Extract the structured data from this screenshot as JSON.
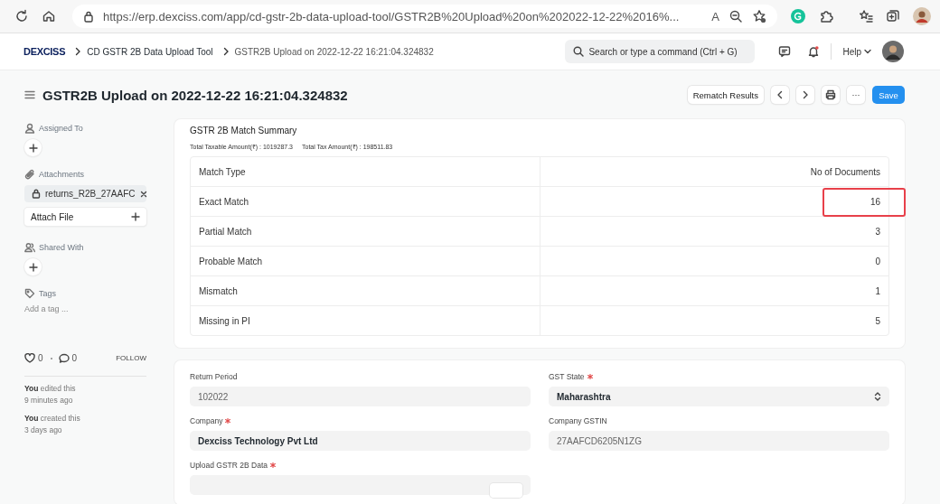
{
  "browser": {
    "url": "https://erp.dexciss.com/app/cd-gstr-2b-data-upload-tool/GSTR2B%20Upload%20on%202022-12-22%2016%...",
    "read_aloud": "A"
  },
  "navbar": {
    "logo": "DEXCISS",
    "breadcrumbs": [
      "CD GSTR 2B Data Upload Tool",
      "GSTR2B Upload on 2022-12-22 16:21:04.324832"
    ],
    "search_placeholder": "Search or type a command (Ctrl + G)",
    "notifications_unread": true,
    "help": "Help"
  },
  "page": {
    "title": "GSTR2B Upload on 2022-12-22 16:21:04.324832",
    "buttons": [
      {
        "kind": "text",
        "label": "Rematch Results"
      },
      {
        "kind": "prev"
      },
      {
        "kind": "next"
      },
      {
        "kind": "print"
      },
      {
        "kind": "more",
        "label": "···"
      },
      {
        "kind": "primary",
        "label": "Save"
      }
    ]
  },
  "sidebar": {
    "sections": [
      {
        "kind": "assign",
        "label": "Assigned To"
      },
      {
        "kind": "attachments",
        "label": "Attachments",
        "files": [
          "returns_R2B_27AAFC"
        ],
        "attach_label": "Attach File"
      },
      {
        "kind": "share",
        "label": "Shared With"
      },
      {
        "kind": "tags",
        "label": "Tags",
        "placeholder": "Add a tag ..."
      }
    ],
    "likes": "0",
    "comments": "0",
    "follow": "FOLLOW",
    "activity": [
      {
        "text": "**You** edited this",
        "time": "9 minutes ago"
      },
      {
        "text": "**You** created this",
        "time": "3 days ago"
      }
    ]
  },
  "summary": {
    "title": "GSTR 2B Match Summary",
    "totals": [
      "Total Taxable Amount(₹) : 1019287.3",
      "Total Tax Amount(₹) : 198511.83"
    ],
    "columns": [
      "Match Type",
      "No of Documents"
    ],
    "rows": [
      {
        "type": "Exact Match",
        "count": "16",
        "highlighted": true
      },
      {
        "type": "Partial Match",
        "count": "3",
        "highlighted": false
      },
      {
        "type": "Probable Match",
        "count": "0",
        "highlighted": false
      },
      {
        "type": "Mismatch",
        "count": "1",
        "highlighted": false
      },
      {
        "type": "Missing in PI",
        "count": "5",
        "highlighted": false
      }
    ]
  },
  "form": {
    "columns": [
      [
        {
          "kind": "data",
          "label": "Return Period",
          "required": false,
          "value": "102022"
        },
        {
          "kind": "link",
          "label": "Company",
          "required": true,
          "value": "Dexciss Technology Pvt Ltd"
        },
        {
          "kind": "attach",
          "label": "Upload GSTR 2B Data",
          "required": true
        }
      ],
      [
        {
          "kind": "select",
          "label": "GST State",
          "required": true,
          "value": "Maharashtra"
        },
        {
          "kind": "data",
          "label": "Company GSTIN",
          "required": false,
          "value": "27AAFCD6205N1ZG"
        }
      ]
    ]
  }
}
